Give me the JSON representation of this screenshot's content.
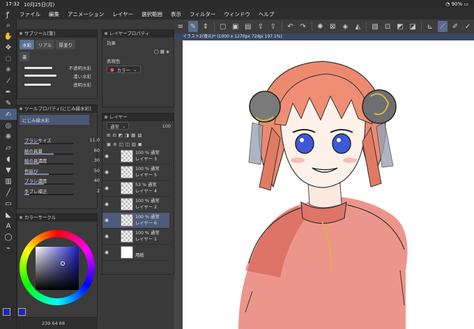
{
  "status_bar": {
    "time": "17:32",
    "date": "10月25日(月)",
    "battery": "90%"
  },
  "menu": {
    "items": [
      "ファイル",
      "編集",
      "アニメーション",
      "レイヤー",
      "選択範囲",
      "表示",
      "フィルター",
      "ウィンドウ",
      "ヘルプ"
    ]
  },
  "subtool_panel": {
    "title": "サブツール[筆]",
    "tabs": [
      "水彩",
      "リアル",
      "厚塗り"
    ],
    "group2": "墨",
    "brushes": [
      "不透明水彩",
      "濃い水彩",
      "透明水彩"
    ]
  },
  "tool_property": {
    "title": "ツールプロパティ[にじみ縁水彩]",
    "brush_name": "にじみ縁水彩",
    "rows": [
      {
        "label": "ブラシサイズ",
        "value": "11.0",
        "fill": 0.3
      },
      {
        "label": "絵の具量",
        "value": "60",
        "fill": 0.6
      },
      {
        "label": "絵の具濃度",
        "value": "30",
        "fill": 0.3
      },
      {
        "label": "色延び",
        "value": "50",
        "fill": 0.5
      },
      {
        "label": "ブラシ濃度",
        "value": "40",
        "fill": 0.4
      },
      {
        "label": "手ブレ補正",
        "value": "2",
        "fill": 0.1
      }
    ]
  },
  "color_panel": {
    "title": "カラーサークル",
    "readout": "239 64 68"
  },
  "layer_property": {
    "title": "レイヤープロパティ",
    "effect_label": "効果",
    "display_color_label": "表現色",
    "display_color_value": "カラー"
  },
  "layers_panel": {
    "title": "レイヤー",
    "blend_mode": "通常",
    "opacity": "100",
    "layers": [
      {
        "opacity": "100 %",
        "mode": "通常",
        "name": "レイヤー 3",
        "selected": false
      },
      {
        "opacity": "100 %",
        "mode": "通常",
        "name": "レイヤー 5",
        "selected": false
      },
      {
        "opacity": "53 %",
        "mode": "通常",
        "name": "レイヤー 4",
        "selected": false
      },
      {
        "opacity": "100 %",
        "mode": "通常",
        "name": "レイヤー 2",
        "selected": false
      },
      {
        "opacity": "100 %",
        "mode": "通常",
        "name": "レイヤー 6",
        "selected": true
      },
      {
        "opacity": "100 %",
        "mode": "通常",
        "name": "レイヤー 1",
        "selected": false
      },
      {
        "opacity": "",
        "mode": "",
        "name": "用紙",
        "selected": false
      }
    ]
  },
  "canvas": {
    "tab_title": "イラスト2(復元)* (1000 x 1270px 72dpi 197.1%)"
  }
}
